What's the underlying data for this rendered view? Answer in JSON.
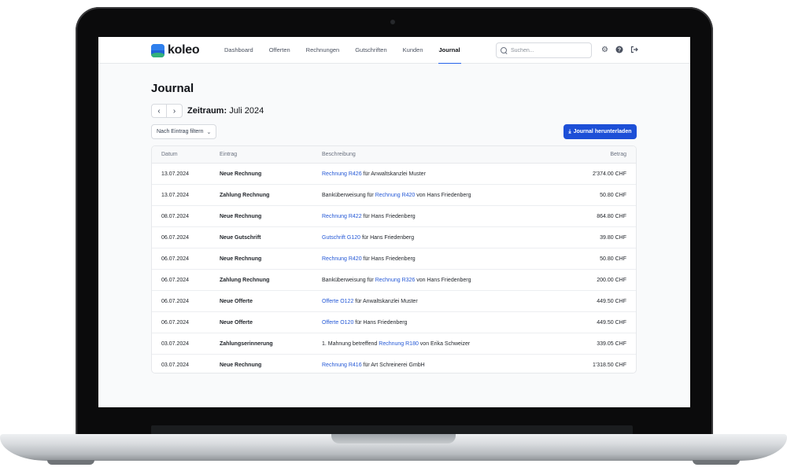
{
  "app": {
    "name": "koleo"
  },
  "nav": {
    "items": [
      {
        "label": "Dashboard"
      },
      {
        "label": "Offerten"
      },
      {
        "label": "Rechnungen"
      },
      {
        "label": "Gutschriften"
      },
      {
        "label": "Kunden"
      },
      {
        "label": "Journal",
        "active": true
      }
    ]
  },
  "search": {
    "placeholder": "Suchen..."
  },
  "page": {
    "title": "Journal",
    "period_label": "Zeitraum:",
    "period_value": "Juli 2024",
    "filter_label": "Nach Eintrag filtern",
    "download_label": "Journal herunterladen"
  },
  "table": {
    "headers": {
      "date": "Datum",
      "entry": "Eintrag",
      "description": "Beschreibung",
      "amount": "Betrag"
    },
    "rows": [
      {
        "date": "13.07.2024",
        "entry": "Neue Rechnung",
        "pre": "",
        "link": "Rechnung R426",
        "post": " für Anwaltskanzlei Muster",
        "amount": "2'374.00 CHF"
      },
      {
        "date": "13.07.2024",
        "entry": "Zahlung Rechnung",
        "pre": "Banküberweisung für ",
        "link": "Rechnung R420",
        "post": " von Hans Friedenberg",
        "amount": "50.80 CHF"
      },
      {
        "date": "08.07.2024",
        "entry": "Neue Rechnung",
        "pre": "",
        "link": "Rechnung R422",
        "post": " für Hans Friedenberg",
        "amount": "864.80 CHF"
      },
      {
        "date": "06.07.2024",
        "entry": "Neue Gutschrift",
        "pre": "",
        "link": "Gutschrift G120",
        "post": " für Hans Friedenberg",
        "amount": "39.80 CHF"
      },
      {
        "date": "06.07.2024",
        "entry": "Neue Rechnung",
        "pre": "",
        "link": "Rechnung R420",
        "post": " für Hans Friedenberg",
        "amount": "50.80 CHF"
      },
      {
        "date": "06.07.2024",
        "entry": "Zahlung Rechnung",
        "pre": "Banküberweisung für ",
        "link": "Rechnung R326",
        "post": " von Hans Friedenberg",
        "amount": "200.00 CHF"
      },
      {
        "date": "06.07.2024",
        "entry": "Neue Offerte",
        "pre": "",
        "link": "Offerte O122",
        "post": " für Anwaltskanzlei Muster",
        "amount": "449.50 CHF"
      },
      {
        "date": "06.07.2024",
        "entry": "Neue Offerte",
        "pre": "",
        "link": "Offerte O120",
        "post": " für Hans Friedenberg",
        "amount": "449.50 CHF"
      },
      {
        "date": "03.07.2024",
        "entry": "Zahlungserinnerung",
        "pre": "1. Mahnung betreffend ",
        "link": "Rechnung R180",
        "post": " von Erika Schweizer",
        "amount": "339.05 CHF"
      },
      {
        "date": "03.07.2024",
        "entry": "Neue Rechnung",
        "pre": "",
        "link": "Rechnung R416",
        "post": " für Art Schreinerei GmbH",
        "amount": "1'318.50 CHF"
      }
    ]
  },
  "icons": {
    "settings": "gear-icon",
    "help": "help-icon",
    "logout": "logout-icon",
    "search": "search-icon",
    "download": "download-icon"
  },
  "colors": {
    "primary": "#1d4fd7",
    "link": "#2458d6",
    "logo_green": "#33b27a"
  }
}
